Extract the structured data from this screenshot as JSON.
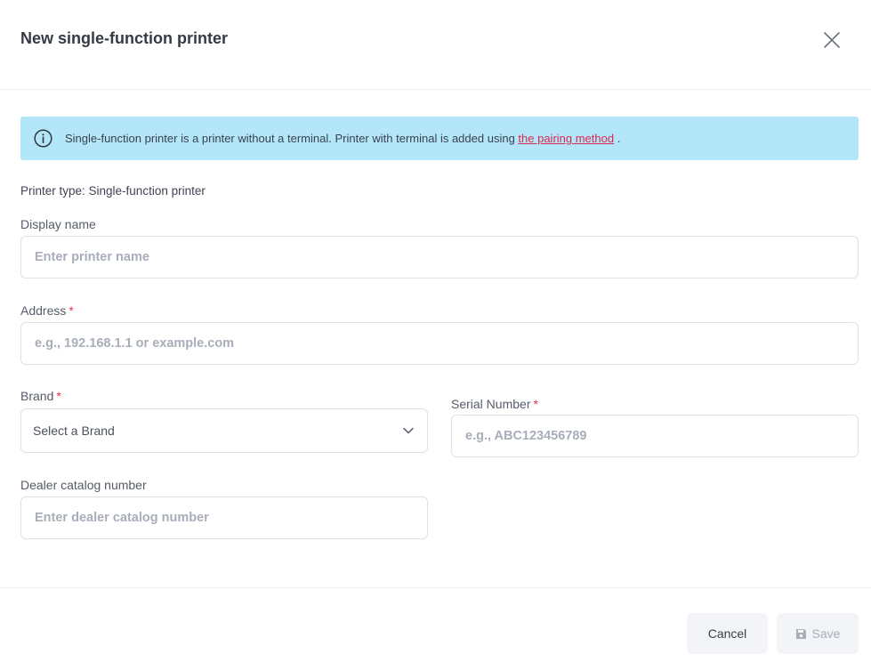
{
  "modal": {
    "title": "New single-function printer"
  },
  "info": {
    "text": "Single-function printer is a printer without a terminal. Printer with terminal is added using ",
    "link": "the pairing method",
    "suffix": " ."
  },
  "printer_type": "Printer type: Single-function printer",
  "form": {
    "display_name": {
      "label": "Display name",
      "placeholder": "Enter printer name"
    },
    "address": {
      "label": "Address",
      "required_mark": "*",
      "placeholder": "e.g., 192.168.1.1 or example.com"
    },
    "brand": {
      "label": "Brand",
      "required_mark": "*",
      "selected": "Select a Brand"
    },
    "serial_number": {
      "label": "Serial Number",
      "required_mark": "*",
      "placeholder": "e.g., ABC123456789"
    },
    "dealer_catalog": {
      "label": "Dealer catalog number",
      "placeholder": "Enter dealer catalog number"
    }
  },
  "footer": {
    "cancel_label": "Cancel",
    "save_label": "Save"
  },
  "icons": {
    "close": "close-icon",
    "info": "info-icon",
    "chevron": "chevron-down-icon",
    "save": "save-icon"
  },
  "colors": {
    "info_bg": "#b3e6f8",
    "link": "#d72a4f",
    "required": "#e5364f"
  }
}
